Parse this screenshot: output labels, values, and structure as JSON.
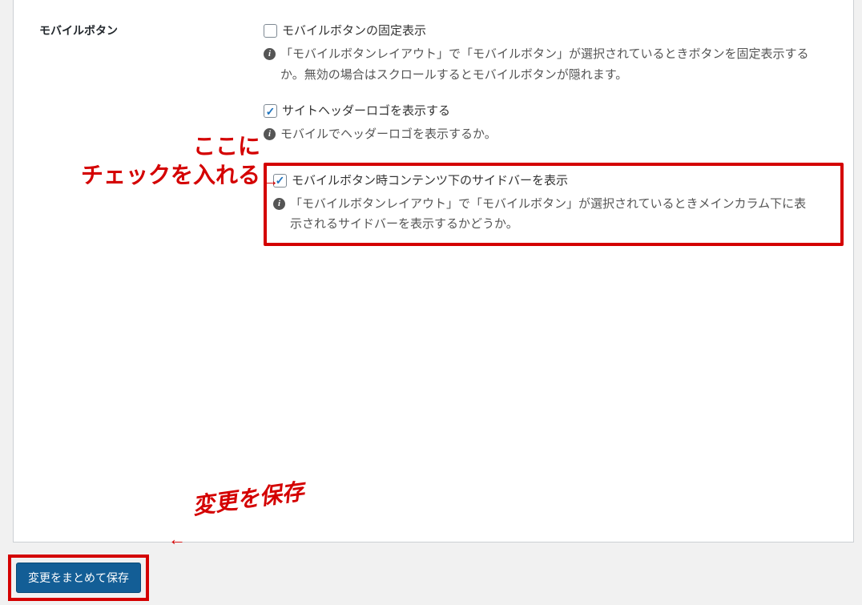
{
  "section": {
    "title": "モバイルボタン"
  },
  "options": [
    {
      "checked": false,
      "label": "モバイルボタンの固定表示",
      "desc": "「モバイルボタンレイアウト」で「モバイルボタン」が選択されているときボタンを固定表示するか。無効の場合はスクロールするとモバイルボタンが隠れます。"
    },
    {
      "checked": true,
      "label": "サイトヘッダーロゴを表示する",
      "desc": "モバイルでヘッダーロゴを表示するか。"
    },
    {
      "checked": true,
      "label": "モバイルボタン時コンテンツ下のサイドバーを表示",
      "desc": "「モバイルボタンレイアウト」で「モバイルボタン」が選択されているときメインカラム下に表示されるサイドバーを表示するかどうか。"
    }
  ],
  "annotations": {
    "check_here_line1": "ここに",
    "check_here_line2": "チェックを入れる",
    "save_changes": "変更を保存"
  },
  "save_button": "変更をまとめて保存"
}
